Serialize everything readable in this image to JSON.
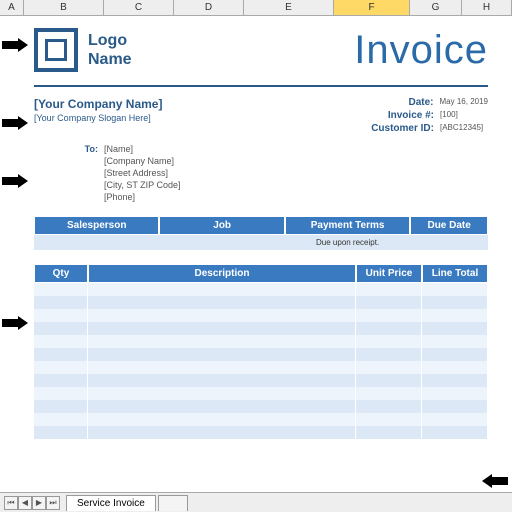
{
  "columns": [
    "A",
    "B",
    "C",
    "D",
    "E",
    "F",
    "G",
    "H"
  ],
  "logo": {
    "line1": "Logo",
    "line2": "Name"
  },
  "title": "Invoice",
  "company": {
    "name": "[Your Company Name]",
    "slogan": "[Your Company Slogan Here]"
  },
  "meta": {
    "date_label": "Date:",
    "date": "May 16, 2019",
    "inv_label": "Invoice #:",
    "inv": "[100]",
    "cust_label": "Customer ID:",
    "cust": "[ABC12345]"
  },
  "to": {
    "label": "To:",
    "lines": [
      "[Name]",
      "[Company Name]",
      "[Street Address]",
      "[City, ST ZIP Code]",
      "[Phone]"
    ]
  },
  "t1": {
    "headers": [
      "Salesperson",
      "Job",
      "Payment Terms",
      "Due Date"
    ],
    "row": [
      "",
      "",
      "Due upon receipt.",
      ""
    ]
  },
  "t2": {
    "headers": [
      "Qty",
      "Description",
      "Unit Price",
      "Line Total"
    ]
  },
  "tab": "Service Invoice"
}
